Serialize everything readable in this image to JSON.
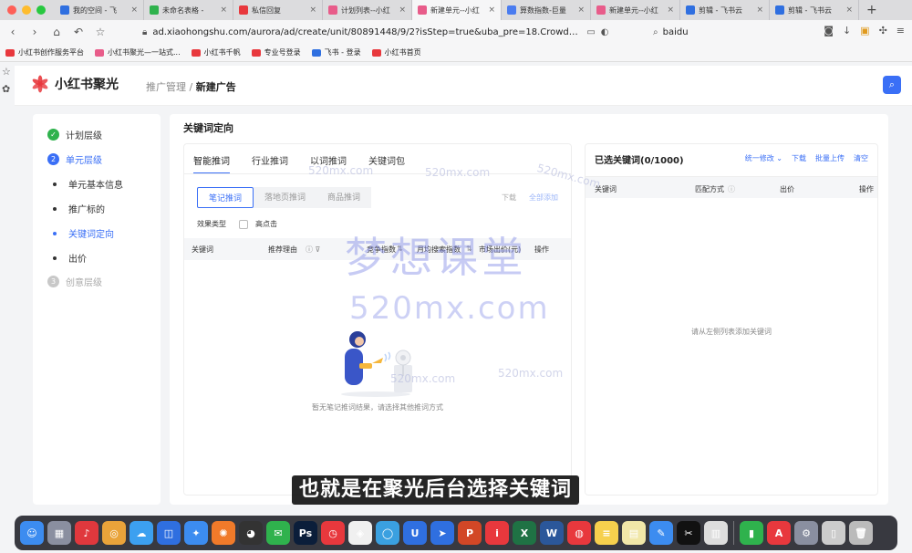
{
  "browser": {
    "tabs": [
      {
        "title": "我的空间 - 飞",
        "color": "#2f6fe0",
        "active": false
      },
      {
        "title": "未命名表格 -",
        "color": "#2fb24d",
        "active": false
      },
      {
        "title": "私信回复",
        "color": "#e8383d",
        "active": false
      },
      {
        "title": "计划列表--小红",
        "color": "#e85c8a",
        "active": false
      },
      {
        "title": "新建单元--小红",
        "color": "#e85c8a",
        "active": true
      },
      {
        "title": "算数指数-巨量",
        "color": "#4a7cf0",
        "active": false
      },
      {
        "title": "新建单元--小红",
        "color": "#e85c8a",
        "active": false
      },
      {
        "title": "剪辑 - 飞书云",
        "color": "#2f6fe0",
        "active": false
      },
      {
        "title": "剪辑 - 飞书云",
        "color": "#2f6fe0",
        "active": false
      }
    ],
    "url": "ad.xiaohongshu.com/aurora/ad/create/unit/80891448/9/2?isStep=true&uba_pre=18.CrowdMa...",
    "search_text": "baidu",
    "bookmarks": [
      "小红书创作服务平台",
      "小红书聚光—一站式...",
      "小红书千帆",
      "专业号登录",
      "飞书 - 登录",
      "小红书首页"
    ]
  },
  "header": {
    "brand": "小红书聚光",
    "breadcrumb_parent": "推广管理",
    "breadcrumb_sep": "/",
    "breadcrumb_current": "新建广告"
  },
  "steps": {
    "plan": {
      "label": "计划层级",
      "num": "✓"
    },
    "unit": {
      "label": "单元层级",
      "num": "2"
    },
    "sub1": "单元基本信息",
    "sub2": "推广标的",
    "sub3": "关键词定向",
    "sub4": "出价",
    "creative": {
      "label": "创意层级",
      "num": "3"
    }
  },
  "main": {
    "section_title": "关键词定向",
    "tabs": [
      "智能推词",
      "行业推词",
      "以词推词",
      "关键词包"
    ],
    "seg": [
      "笔记推词",
      "落地页推词",
      "商品推词"
    ],
    "seg_actions": {
      "download": "下载",
      "add_all": "全部添加"
    },
    "filter_label": "效果类型",
    "filter_option": "高点击",
    "table_headers": {
      "keyword": "关键词",
      "reason": "推荐理由",
      "competition": "竞争指数",
      "monthly_search": "月均搜索指数",
      "market_bid": "市场出价(元)",
      "action": "操作"
    },
    "empty_text": "暂无笔记推词结果，请选择其他推词方式"
  },
  "selected": {
    "title": "已选关键词(0/1000)",
    "actions": {
      "batch_edit": "统一修改 ⌄",
      "download": "下载",
      "batch_upload": "批量上传",
      "clear": "清空"
    },
    "headers": {
      "keyword": "关键词",
      "match": "匹配方式",
      "bid": "出价",
      "action": "操作"
    },
    "empty_text": "请从左侧列表添加关键词"
  },
  "watermark": {
    "big": "梦想课堂",
    "mid": "520mx.com",
    "small": "520mx.com"
  },
  "subtitle": "也就是在聚光后台选择关键词"
}
